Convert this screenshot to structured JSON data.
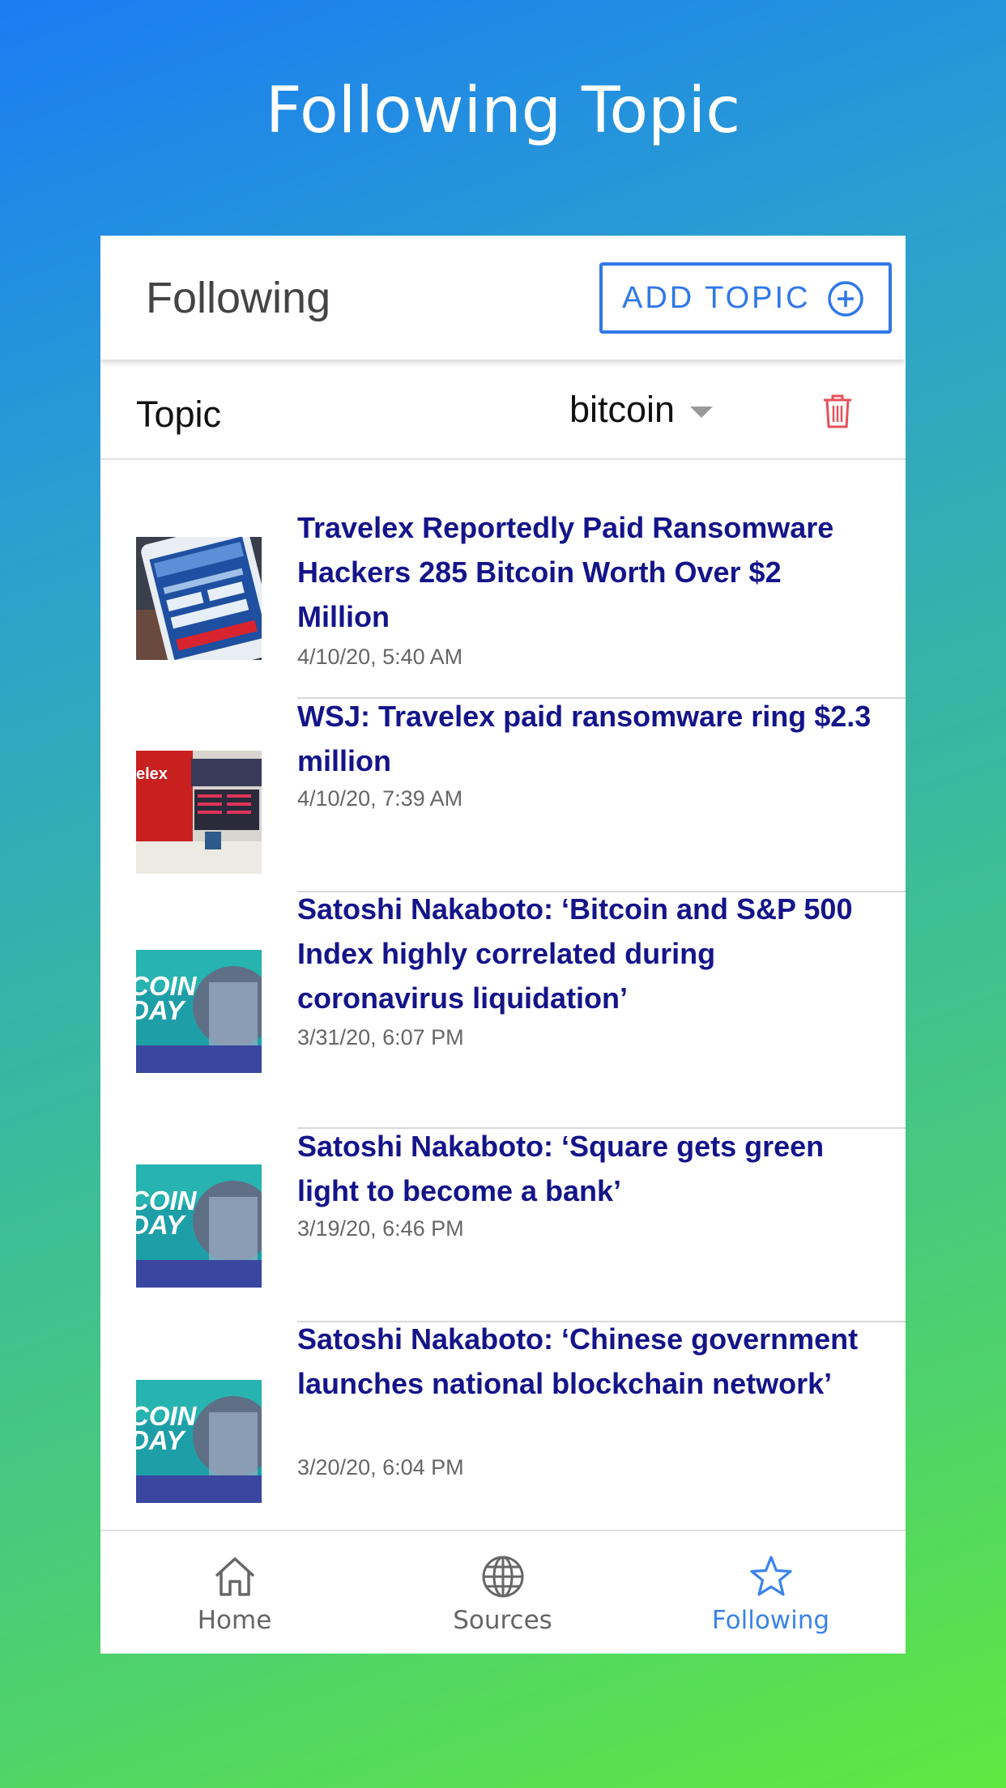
{
  "promo": {
    "title": "Following Topic"
  },
  "header": {
    "title": "Following",
    "add_topic_label": "ADD TOPIC"
  },
  "topic": {
    "label": "Topic",
    "value": "bitcoin"
  },
  "articles": [
    {
      "headline": "Travelex Reportedly Paid Ransomware Hackers 285 Bitcoin Worth Over $2 Million",
      "date": "4/10/20, 5:40 AM",
      "thumb": "phone-app"
    },
    {
      "headline": "WSJ: Travelex paid ransomware ring $2.3 million",
      "date": "4/10/20, 7:39 AM",
      "thumb": "currency-exchange"
    },
    {
      "headline": "Satoshi Nakaboto: ‘Bitcoin and S&P 500 Index highly correlated during coronavirus liquidation’",
      "date": "3/31/20, 6:07 PM",
      "thumb": "bitcoin-today"
    },
    {
      "headline": "Satoshi Nakaboto: ‘Square gets green light to become a bank’",
      "date": "3/19/20, 6:46 PM",
      "thumb": "bitcoin-today"
    },
    {
      "headline": "Satoshi Nakaboto: ‘Chinese government launches national blockchain network’",
      "date": "3/20/20, 6:04 PM",
      "thumb": "bitcoin-today"
    }
  ],
  "thumb_text": {
    "coin": "COIN",
    "day": "DAY",
    "brand": "elex"
  },
  "tabs": [
    {
      "label": "Home",
      "icon": "home-icon"
    },
    {
      "label": "Sources",
      "icon": "globe-icon"
    },
    {
      "label": "Following",
      "icon": "star-icon",
      "active": true
    }
  ],
  "colors": {
    "accent": "#2f78e8",
    "headline": "#14148a",
    "delete": "#e8505b"
  }
}
